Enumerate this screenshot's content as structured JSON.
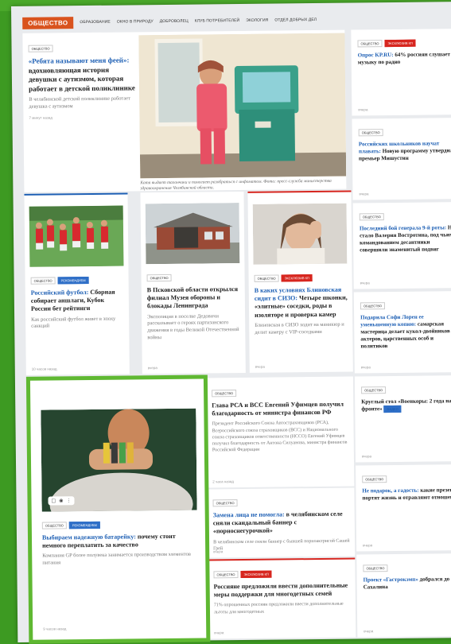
{
  "nav": {
    "logo": "ОБЩЕСТВО",
    "links": [
      "ОБРАЗОВАНИЕ",
      "ОКНО В ПРИРОДУ",
      "ДОБРОВОЛЕЦ",
      "КЛУБ ПОТРЕБИТЕЛЕЙ",
      "ЭКОЛОГИЯ",
      "ОТДЕЛ ДОБРЫХ ДЕЛ"
    ]
  },
  "feature": {
    "tag": "ОБЩЕСТВО",
    "title_blue": "«Ребята называют меня феей»:",
    "title_rest": " вдохновляющая история девушки с аутизмом, которая работает в детской поликлинике",
    "lead": "В челябинской детской поликлинике работает девушка с аутизмом",
    "time": "7 минут назад",
    "photo_caption": "Катя выдает талончики и помогает разобраться с инфоматом. Фото: пресс-служба министерства здравоохранения Челябинской области."
  },
  "row2": [
    {
      "tags": [
        "ОБЩЕСТВО",
        "РЕКОМЕНДУЕМ"
      ],
      "title_blue": "Российский футбол:",
      "title_rest": " Сборная собирает аншлаги, Кубок России бет рейтинги",
      "lead": "Как российский футбол живет в эпоху санкций",
      "time": "10 часов назад"
    },
    {
      "tags": [
        "ОБЩЕСТВО"
      ],
      "title_blue": "",
      "title_rest": "В Псковской области открылся филиал Музея обороны и блокады Ленинграда",
      "lead": "Экспозиция в поселке Дедовичи рассказывает о героях партизанского движения в годы Великой Отечественной войны",
      "time": "вчера"
    },
    {
      "tags": [
        "ОБЩЕСТВО",
        "ЭКСКЛЮЗИВ КП"
      ],
      "title_blue": "В каких условиях Блиновская сидит в СИЗО:",
      "title_rest": " Четыре шконки, «элитные» соседки, роды в изоляторе и проверка камер",
      "lead": "Блиновская в СИЗО ходит на маникюр и делит камеру с VIP-соседками",
      "time": "вчера"
    }
  ],
  "battery": {
    "tags": [
      "ОБЩЕСТВО",
      "РЕКОМЕНДУЕМ"
    ],
    "title_blue": "Выбираем надежную батарейку:",
    "title_rest": " почему стоит немного переплатить за качество",
    "lead": "Компания GP более полувека занимается производством элементов питания",
    "time": "9 часов назад"
  },
  "middle": [
    {
      "tags": [
        "ОБЩЕСТВО"
      ],
      "title_blue": "",
      "title_rest": "Глава РСА и ВСС Евгений Уфимцев получил благодарность от министра финансов РФ",
      "lead": "Президент Российского Союза Автостраховщиков (РСА), Всероссийского союза страховщиков (ВСС) и Национального союза страховщиков ответственности (НССО) Евгений Уфимцев получил благодарность от Антона Силуанова, министра финансов Российской Федерации",
      "time": "2 часа назад"
    },
    {
      "tags": [
        "ОБЩЕСТВО"
      ],
      "title_blue": "Замена лица не помогла:",
      "title_rest": " в челябинском селе сняли скандальный баннер с «порноснегурочкой»",
      "lead": "В челябинском селе сняли баннер с бывшей порноактрисой Сашей Грей",
      "time": "вчера"
    },
    {
      "tags": [
        "ОБЩЕСТВО",
        "ЭКСКЛЮЗИВ КП"
      ],
      "title_blue": "",
      "title_rest": "Россияне предложили ввести дополнительные меры поддержки для многодетных семей",
      "lead": "71% опрошенных россиян предложили ввести дополнительные льготы для многодетных",
      "time": "вчера"
    }
  ],
  "sidebar": [
    {
      "tags": [
        "ОБЩЕСТВО",
        "ЭКСКЛЮЗИВ КП"
      ],
      "title_blue": "Опрос KP.RU:",
      "title_rest": " 64% россиян слушает музыку по радио",
      "time": "вчера"
    },
    {
      "tags": [
        "ОБЩЕСТВО"
      ],
      "title_blue": "Российских школьников научат плавать:",
      "title_rest": " Новую программу утвердил премьер Мишустин",
      "time": "вчера"
    },
    {
      "tags": [
        "ОБЩЕСТВО"
      ],
      "title_blue": "Последний бой генерала 9-й роты:",
      "title_rest": " Не стало Валерия Востротина, под чьим командованием десантники совершили знаменитый подвиг",
      "time": "вчера"
    },
    {
      "tags": [
        "ОБЩЕСТВО"
      ],
      "title_blue": "Подарила Софи Лорен ее уменьшенную копию:",
      "title_rest": " самарская мастерица делает кукол-двойников актеров, царственных особ и политиков",
      "time": "вчера"
    },
    {
      "tags": [
        "ОБЩЕСТВО"
      ],
      "title_blue": "",
      "title_rest": "Круглый стол «Военкоры: 2 года на фронте»",
      "badge": "ВИДЕО",
      "time": "вчера"
    },
    {
      "tags": [
        "ОБЩЕСТВО"
      ],
      "title_blue": "Не подарок, а гадость:",
      "title_rest": " какие презенты портят жизнь и отравляют отношения",
      "time": "вчера"
    },
    {
      "tags": [
        "ОБЩЕСТВО"
      ],
      "title_blue": "Проект «Гастрокэмп»",
      "title_rest": " добрался до Сахалина",
      "time": "вчера"
    }
  ],
  "colors": {
    "brand": "#d9531e",
    "accent_blue": "#1d5fb4",
    "tag_red": "#d7261f",
    "frame_green": "#5fb832"
  }
}
